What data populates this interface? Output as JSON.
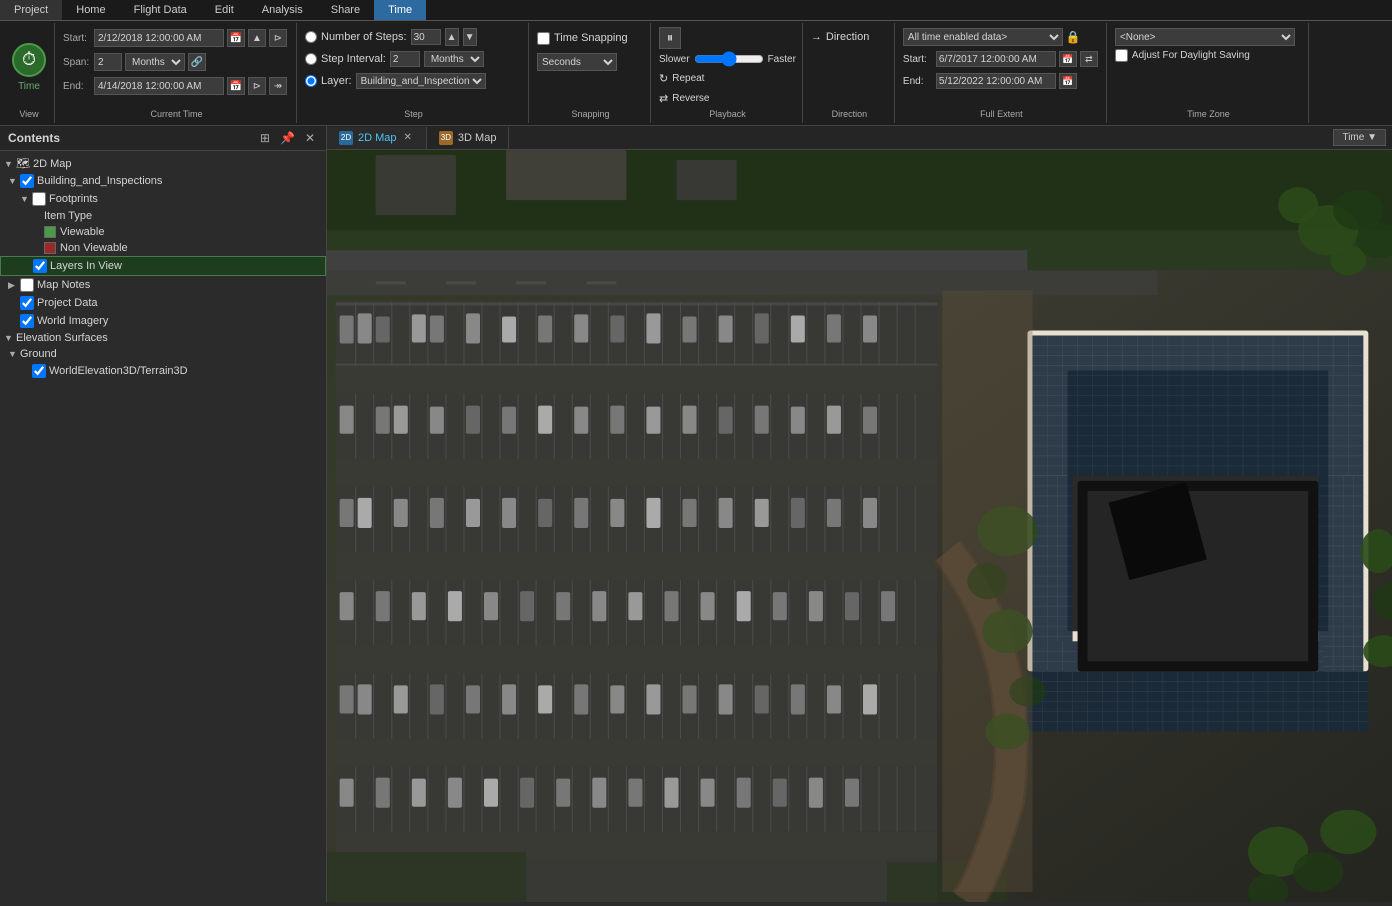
{
  "ribbon": {
    "tabs": [
      "Project",
      "Home",
      "Flight Data",
      "Edit",
      "Analysis",
      "Share",
      "Time"
    ],
    "active_tab": "Time",
    "groups": {
      "view": {
        "title": "View",
        "time_icon": "⏱",
        "label": "Time"
      },
      "current_time": {
        "title": "Current Time",
        "start_label": "Start:",
        "start_value": "2/12/2018 12:00:00 AM",
        "span_label": "Span:",
        "span_value": "2",
        "span_unit": "Months",
        "end_label": "End:",
        "end_value": "4/14/2018 12:00:00 AM"
      },
      "step": {
        "title": "Step",
        "number_of_steps_label": "Number of Steps:",
        "number_of_steps_value": "30",
        "step_interval_label": "Step Interval:",
        "step_interval_value": "2",
        "step_interval_unit": "Months",
        "layer_label": "Layer:",
        "layer_value": "Building_and_Inspections"
      },
      "snapping": {
        "title": "Snapping",
        "time_snapping_label": "Time Snapping",
        "seconds_label": "Seconds"
      },
      "playback": {
        "title": "Playback",
        "slower_label": "Slower",
        "faster_label": "Faster",
        "repeat_label": "Repeat",
        "reverse_label": "Reverse"
      },
      "direction": {
        "title": "Direction",
        "label": "Direction"
      },
      "full_extent": {
        "title": "Full Extent",
        "dropdown_value": "All time enabled data>",
        "start_label": "Start:",
        "start_value": "6/7/2017 12:00:00 AM",
        "end_label": "End:",
        "end_value": "5/12/2022 12:00:00 AM"
      },
      "time_zone": {
        "title": "Time Zone",
        "none_value": "<None>",
        "adjust_label": "Adjust For Daylight Saving"
      }
    }
  },
  "contents": {
    "title": "Contents",
    "tree": [
      {
        "id": "2d-map",
        "label": "2D Map",
        "level": 0,
        "type": "map",
        "expanded": true,
        "checked": null
      },
      {
        "id": "building-inspections",
        "label": "Building_and_Inspections",
        "level": 1,
        "type": "layer",
        "expanded": true,
        "checked": true
      },
      {
        "id": "footprints",
        "label": "Footprints",
        "level": 2,
        "type": "folder",
        "expanded": true,
        "checked": false
      },
      {
        "id": "item-type",
        "label": "Item Type",
        "level": 3,
        "type": "label",
        "checked": null
      },
      {
        "id": "viewable",
        "label": "Viewable",
        "level": 3,
        "type": "legend-green",
        "checked": null
      },
      {
        "id": "non-viewable",
        "label": "Non Viewable",
        "level": 3,
        "type": "legend-red",
        "checked": null
      },
      {
        "id": "layers-in-view",
        "label": "Layers In View",
        "level": 2,
        "type": "layer",
        "checked": true,
        "highlighted": true
      },
      {
        "id": "map-notes",
        "label": "Map Notes",
        "level": 1,
        "type": "folder",
        "checked": false
      },
      {
        "id": "project-data",
        "label": "Project Data",
        "level": 1,
        "type": "layer",
        "checked": true
      },
      {
        "id": "world-imagery",
        "label": "World Imagery",
        "level": 1,
        "type": "layer",
        "checked": true
      },
      {
        "id": "elevation-surfaces",
        "label": "Elevation Surfaces",
        "level": 0,
        "type": "section",
        "expanded": true
      },
      {
        "id": "ground",
        "label": "Ground",
        "level": 1,
        "type": "folder",
        "expanded": true
      },
      {
        "id": "world-elevation",
        "label": "WorldElevation3D/Terrain3D",
        "level": 2,
        "type": "layer",
        "checked": true
      }
    ]
  },
  "map": {
    "tabs": [
      {
        "id": "2d-map",
        "label": "2D Map",
        "type": "2d",
        "active": true,
        "closeable": true
      },
      {
        "id": "3d-map",
        "label": "3D Map",
        "type": "3d",
        "active": false,
        "closeable": false
      }
    ],
    "time_badge": "Time ▼"
  }
}
